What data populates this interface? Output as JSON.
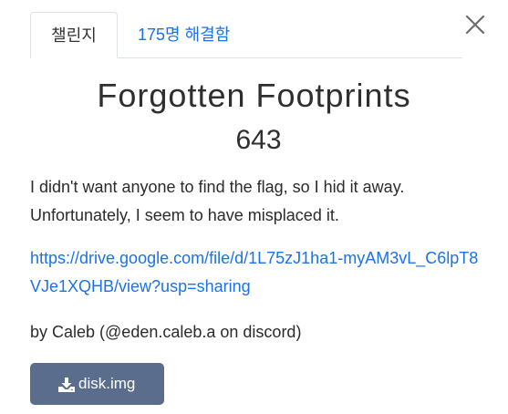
{
  "tabs": {
    "challenge_label": "챌린지",
    "solves_label": "175명 해결함"
  },
  "challenge": {
    "name": "Forgotten Footprints",
    "points": "643",
    "description": "I didn't want anyone to find the flag, so I hid it away. Unfortunately, I seem to have misplaced it.",
    "link": "https://drive.google.com/file/d/1L75zJ1ha1-myAM3vL_C6lpT8VJe1XQHB/view?usp=sharing",
    "author": "by Caleb (@eden.caleb.a on discord)"
  },
  "files": {
    "download_label": "disk.img",
    "download_icon": "download-icon"
  },
  "colors": {
    "link": "#1a73e8",
    "button_bg": "#5b6d8c",
    "close_icon": "#6c6c6c"
  }
}
